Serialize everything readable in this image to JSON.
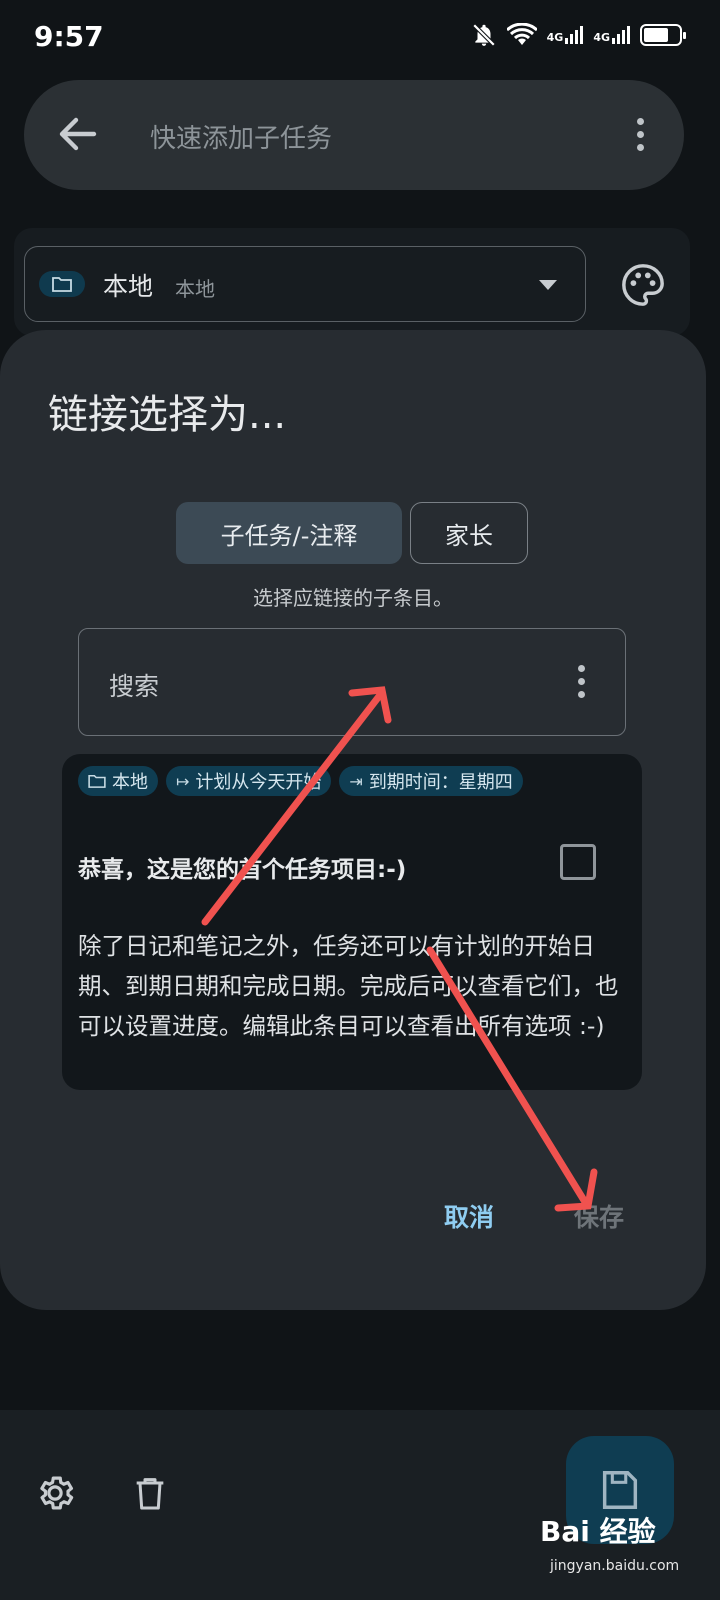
{
  "status_bar": {
    "time": "9:57",
    "network_label_1": "4G",
    "network_label_2": "4G"
  },
  "top_bar": {
    "placeholder": "快速添加子任务"
  },
  "collection": {
    "name": "本地",
    "sub": "本地"
  },
  "dialog": {
    "title": "链接选择为...",
    "segments": [
      {
        "label": "子任务/-注释"
      },
      {
        "label": "家长"
      }
    ],
    "hint": "选择应链接的子条目。",
    "search_label": "搜索",
    "task": {
      "tags": [
        {
          "icon": "folder-icon",
          "label": "本地"
        },
        {
          "icon": "start-icon",
          "label": "计划从今天开始"
        },
        {
          "icon": "due-icon",
          "label": "到期时间：星期四"
        }
      ],
      "title": "恭喜，这是您的首个任务项目:-)",
      "description": "除了日记和笔记之外，任务还可以有计划的开始日期、到期日期和完成日期。完成后可以查看它们，也可以设置进度。编辑此条目可以查看出所有选项 :-)"
    },
    "cancel_label": "取消",
    "save_label": "保存"
  },
  "watermark": {
    "brand": "Bai  经验",
    "url": "jingyan.baidu.com"
  },
  "colors": {
    "accent": "#8fcdf1",
    "chip_bg": "#0f3d52",
    "arrow": "#f0524f"
  }
}
